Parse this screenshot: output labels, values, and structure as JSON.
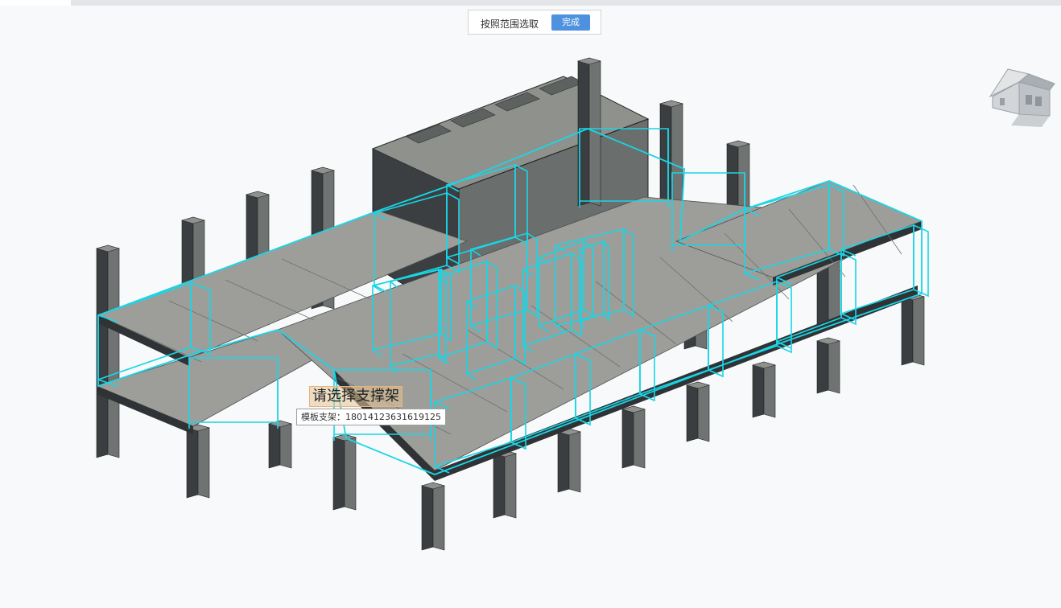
{
  "toolbar": {
    "range_select_label": "按照范围选取",
    "done_label": "完成",
    "done_color": "#4e92df"
  },
  "viewport": {
    "prompt_text": "请选择支撑架",
    "tooltip_text": "模板支架：18014123631619125",
    "highlight_color": "#19d6e6",
    "slab_color": "#9d9e99",
    "column_color": "#2c3033",
    "navigation_widget": "view-cube-house-icon"
  }
}
